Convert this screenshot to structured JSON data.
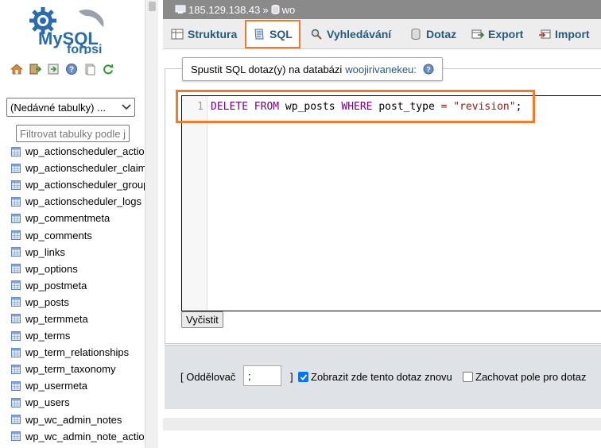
{
  "sidebar": {
    "logo": {
      "line1": "MySQL",
      "line2": "forpsi"
    },
    "recent_select": "(Nedávné tabulky) ...",
    "filter_placeholder": "Filtrovat tabulky podle jm",
    "tables": [
      "wp_actionscheduler_actio",
      "wp_actionscheduler_claim",
      "wp_actionscheduler_group",
      "wp_actionscheduler_logs",
      "wp_commentmeta",
      "wp_comments",
      "wp_links",
      "wp_options",
      "wp_postmeta",
      "wp_posts",
      "wp_termmeta",
      "wp_terms",
      "wp_term_relationships",
      "wp_term_taxonomy",
      "wp_usermeta",
      "wp_users",
      "wp_wc_admin_notes",
      "wp_wc_admin_note_actio"
    ]
  },
  "breadcrumb": {
    "server": "185.129.138.43",
    "separator": "»",
    "database": "wo"
  },
  "tabs": [
    {
      "label": "Struktura",
      "icon": "structure-icon"
    },
    {
      "label": "SQL",
      "icon": "sql-icon"
    },
    {
      "label": "Vyhledávání",
      "icon": "search-icon"
    },
    {
      "label": "Dotaz",
      "icon": "query-icon"
    },
    {
      "label": "Export",
      "icon": "export-icon"
    },
    {
      "label": "Import",
      "icon": "import-icon"
    }
  ],
  "query_panel": {
    "title": "Spustit SQL dotaz(y) na databázi",
    "database": "woojirivanekeu:"
  },
  "editor": {
    "line_number": "1",
    "tokens": {
      "delete_from": "DELETE FROM",
      "table": "wp_posts",
      "where": "WHERE",
      "column": "post_type",
      "operator": "=",
      "value": "\"revision\"",
      "terminator": ";"
    }
  },
  "buttons": {
    "clear": "Vyčistit"
  },
  "options": {
    "delimiter_label": "[ Oddělovač",
    "delimiter_value": ";",
    "delimiter_close": "]",
    "show_query_label": "Zobrazit zde tento dotaz znovu",
    "show_query_checked": true,
    "retain_box_label": "Zachovat pole pro dotaz",
    "retain_box_checked": false
  },
  "colors": {
    "accent_highlight": "#f5792a",
    "link": "#235a81",
    "breadcrumb_bg": "#8a8a8a"
  }
}
